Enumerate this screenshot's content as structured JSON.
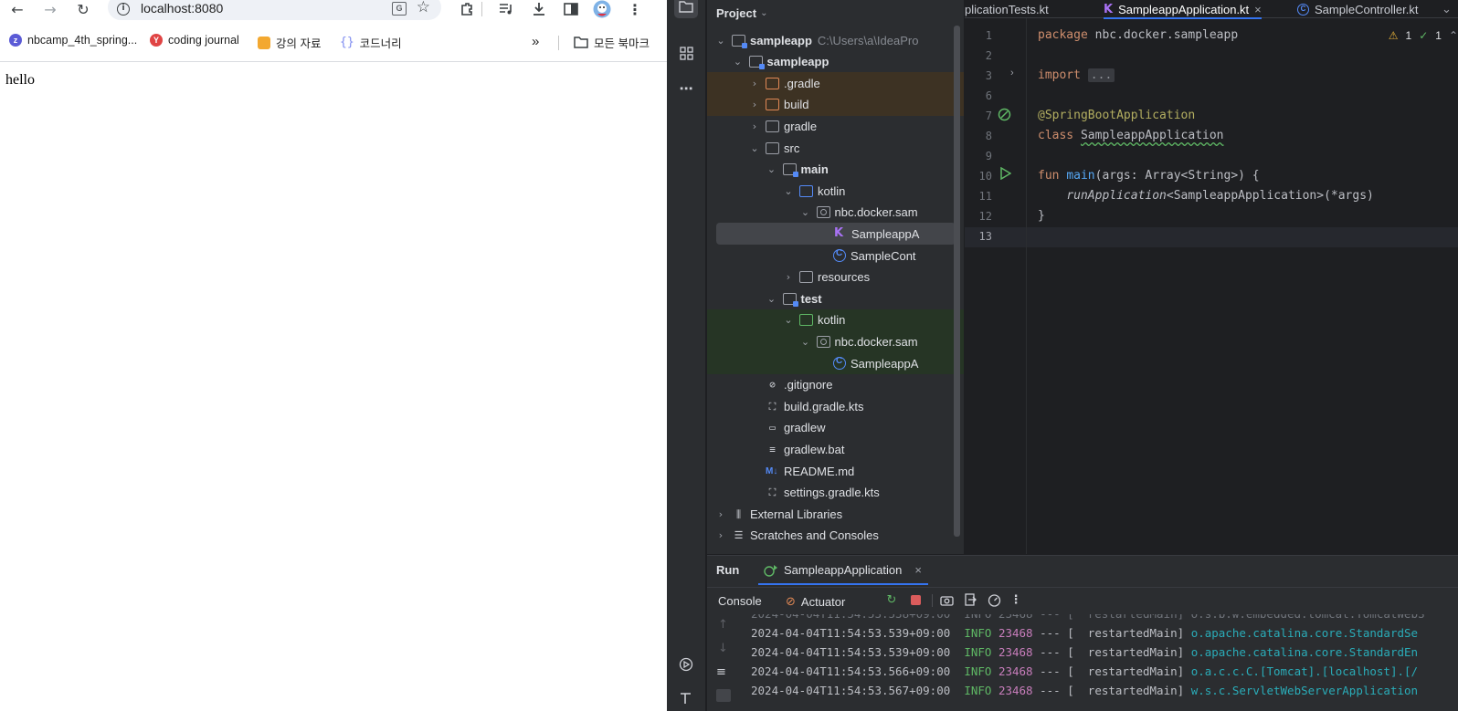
{
  "browser": {
    "url": "localhost:8080",
    "page_text": "hello",
    "bookmarks": [
      {
        "label": "nbcamp_4th_spring...",
        "color": "#5b5bd6"
      },
      {
        "label": "coding journal",
        "color": "#e04444"
      },
      {
        "label": "강의 자료",
        "color": "#f3a830"
      },
      {
        "label": "코드너리",
        "color": "#7e8cf0"
      }
    ],
    "bookmarks_more": "»",
    "all_bookmarks": "모든 북마크"
  },
  "ide": {
    "project_label": "Project",
    "tree": [
      {
        "label": "sampleapp",
        "path": "C:\\Users\\a\\IdeaPro",
        "indent": 0,
        "chev": "v",
        "icon": "folder mod",
        "bold": true
      },
      {
        "label": "sampleapp",
        "indent": 1,
        "chev": "v",
        "icon": "folder mod",
        "bold": true
      },
      {
        "label": ".gradle",
        "indent": 2,
        "chev": ">",
        "icon": "folder orange",
        "highlight": "excluded"
      },
      {
        "label": "build",
        "indent": 2,
        "chev": ">",
        "icon": "folder orange",
        "highlight": "excluded"
      },
      {
        "label": "gradle",
        "indent": 2,
        "chev": ">",
        "icon": "folder"
      },
      {
        "label": "src",
        "indent": 2,
        "chev": "v",
        "icon": "folder"
      },
      {
        "label": "main",
        "indent": 3,
        "chev": "v",
        "icon": "folder mod",
        "bold": true
      },
      {
        "label": "kotlin",
        "indent": 4,
        "chev": "v",
        "icon": "folder blue"
      },
      {
        "label": "nbc.docker.sam",
        "indent": 5,
        "chev": "v",
        "icon": "pkg"
      },
      {
        "label": "SampleappA",
        "indent": 6,
        "chev": "",
        "icon": "kt",
        "selected": true
      },
      {
        "label": "SampleCont",
        "indent": 6,
        "chev": "",
        "icon": "cls"
      },
      {
        "label": "resources",
        "indent": 4,
        "chev": ">",
        "icon": "folder"
      },
      {
        "label": "test",
        "indent": 3,
        "chev": "v",
        "icon": "folder mod",
        "bold": true
      },
      {
        "label": "kotlin",
        "indent": 4,
        "chev": "v",
        "icon": "folder green",
        "highlight": "test"
      },
      {
        "label": "nbc.docker.sam",
        "indent": 5,
        "chev": "v",
        "icon": "pkg",
        "highlight": "test"
      },
      {
        "label": "SampleappA",
        "indent": 6,
        "chev": "",
        "icon": "cls",
        "highlight": "test"
      },
      {
        "label": ".gitignore",
        "indent": 2,
        "chev": "",
        "icon": "file-ban"
      },
      {
        "label": "build.gradle.kts",
        "indent": 2,
        "chev": "",
        "icon": "file-gradle"
      },
      {
        "label": "gradlew",
        "indent": 2,
        "chev": "",
        "icon": "file-term"
      },
      {
        "label": "gradlew.bat",
        "indent": 2,
        "chev": "",
        "icon": "file-lines"
      },
      {
        "label": "README.md",
        "indent": 2,
        "chev": "",
        "icon": "md"
      },
      {
        "label": "settings.gradle.kts",
        "indent": 2,
        "chev": "",
        "icon": "file-gradle"
      },
      {
        "label": "External Libraries",
        "indent": 0,
        "chev": ">",
        "icon": "lib"
      },
      {
        "label": "Scratches and Consoles",
        "indent": 0,
        "chev": ">",
        "icon": "scratch"
      }
    ],
    "tabs": [
      {
        "label": "plicationTests.kt",
        "icon": "none",
        "active": false
      },
      {
        "label": "SampleappApplication.kt",
        "icon": "kt",
        "active": true,
        "close": "×"
      },
      {
        "label": "SampleController.kt",
        "icon": "cls",
        "active": false
      }
    ],
    "tabs_more": "⌄",
    "inspections": {
      "warnings": "1",
      "ok": "1"
    },
    "code_lines": {
      "l1": {
        "num": "1",
        "kw": "package",
        "rest": " nbc.docker.sampleapp"
      },
      "l2": {
        "num": "2"
      },
      "l3": {
        "num": "3",
        "kw": "import",
        "fold": "..."
      },
      "l4": {
        "num": "6"
      },
      "l5": {
        "num": "7",
        "ann": "@SpringBootApplication"
      },
      "l6": {
        "num": "8",
        "kw": "class",
        "name": "SampleappApplication"
      },
      "l7": {
        "num": "9"
      },
      "l8": {
        "num": "10",
        "kw": "fun",
        "fn": "main",
        "rest": "(args: Array<String>) {"
      },
      "l9": {
        "num": "11",
        "indent": "    ",
        "it": "runApplication",
        "rest": "<SampleappApplication>(*args)"
      },
      "l10": {
        "num": "12",
        "rest": "}"
      },
      "l11": {
        "num": "13"
      }
    },
    "run": {
      "title": "Run",
      "config": "SampleappApplication",
      "close": "×",
      "console": "Console",
      "actuator": "Actuator"
    },
    "log": [
      {
        "ts": "2024-04-04T11:54:53.539+09:00",
        "lvl": "INFO",
        "pid": "23468",
        "sep": " --- [",
        "thread": "  restartedMain]",
        "logger": "o.apache.catalina.core.StandardSe"
      },
      {
        "ts": "2024-04-04T11:54:53.539+09:00",
        "lvl": "INFO",
        "pid": "23468",
        "sep": " --- [",
        "thread": "  restartedMain]",
        "logger": "o.apache.catalina.core.StandardEn"
      },
      {
        "ts": "2024-04-04T11:54:53.566+09:00",
        "lvl": "INFO",
        "pid": "23468",
        "sep": " --- [",
        "thread": "  restartedMain]",
        "logger": "o.a.c.c.C.[Tomcat].[localhost].[/"
      },
      {
        "ts": "2024-04-04T11:54:53.567+09:00",
        "lvl": "INFO",
        "pid": "23468",
        "sep": " --- [",
        "thread": "  restartedMain]",
        "logger": "w.s.c.ServletWebServerApplication"
      }
    ]
  }
}
